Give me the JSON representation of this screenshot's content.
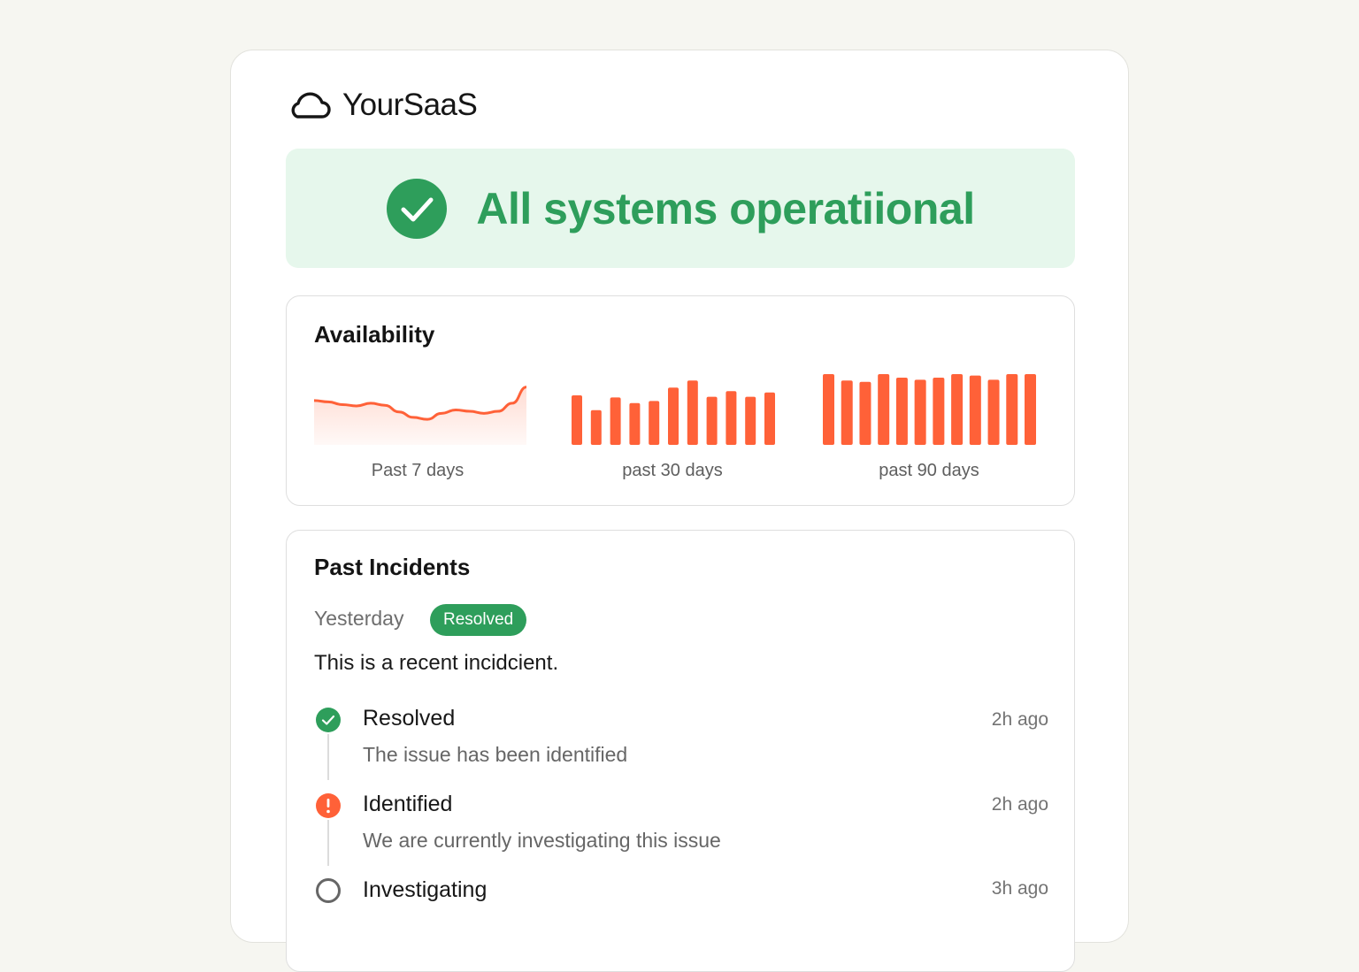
{
  "brand": {
    "name": "YourSaaS",
    "icon": "cloud-icon"
  },
  "status_banner": {
    "text": "All systems operatiional",
    "icon": "check-circle-icon",
    "color": "#2e9e5b",
    "background": "#e6f7ec"
  },
  "availability": {
    "title": "Availability",
    "accent_color": "#ff6138",
    "charts": [
      {
        "label": "Past 7 days"
      },
      {
        "label": "past 30 days"
      },
      {
        "label": "past 90 days"
      }
    ]
  },
  "chart_data": [
    {
      "type": "area",
      "title": "",
      "label": "Past 7 days",
      "values": [
        0.62,
        0.6,
        0.56,
        0.54,
        0.58,
        0.55,
        0.45,
        0.37,
        0.34,
        0.43,
        0.48,
        0.46,
        0.43,
        0.46,
        0.58,
        0.82
      ]
    },
    {
      "type": "bar",
      "title": "",
      "label": "past 30 days",
      "values": [
        0.7,
        0.49,
        0.67,
        0.59,
        0.62,
        0.81,
        0.91,
        0.68,
        0.76,
        0.68,
        0.74
      ]
    },
    {
      "type": "bar",
      "title": "",
      "label": "past 90 days",
      "values": [
        1.0,
        0.91,
        0.89,
        1.0,
        0.95,
        0.92,
        0.95,
        1.0,
        0.98,
        0.92,
        1.0,
        1.0
      ]
    }
  ],
  "incidents": {
    "title": "Past Incidents",
    "date": "Yesterday",
    "badge": "Resolved",
    "badge_color": "#2e9e5b",
    "description": "This is a recent incidcient.",
    "timeline": [
      {
        "title": "Resolved",
        "detail": "The issue has been identified",
        "time": "2h ago",
        "icon": "check-circle-icon",
        "color": "#2e9e5b"
      },
      {
        "title": "Identified",
        "detail": "We are currently investigating this issue",
        "time": "2h ago",
        "icon": "alert-circle-icon",
        "color": "#ff6138"
      },
      {
        "title": "Investigating",
        "detail": "",
        "time": "3h ago",
        "icon": "empty-circle-icon",
        "color": "#666666"
      }
    ]
  }
}
